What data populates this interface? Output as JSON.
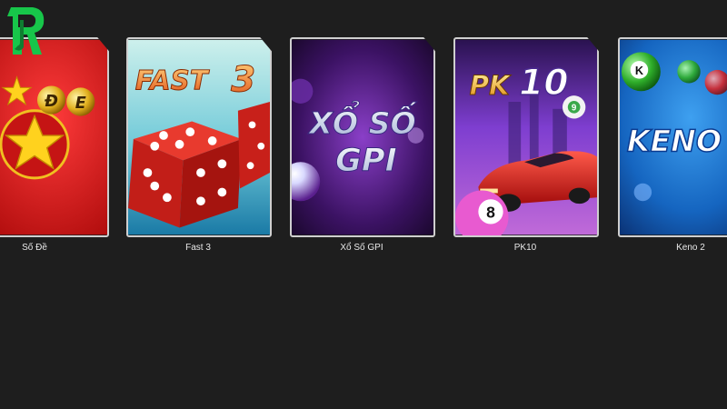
{
  "colors": {
    "background": "#1e1e1e",
    "card_border": "#cfcfcf",
    "logo_green": "#17c64a",
    "caption": "#e8e8e8"
  },
  "logo": {
    "icon": "brand-logo-icon"
  },
  "games": [
    {
      "id": "so-de",
      "title": "Số Đề",
      "art_text": [
        "Đ",
        "E"
      ]
    },
    {
      "id": "fast-3",
      "title": "Fast 3",
      "art_text": [
        "FAST",
        "3"
      ]
    },
    {
      "id": "xo-so-gpi",
      "title": "Xổ Số GPI",
      "art_text": [
        "XỔ SỐ",
        "GPI"
      ]
    },
    {
      "id": "pk10",
      "title": "PK10",
      "art_text": [
        "PK",
        "10"
      ],
      "ball_numbers": [
        "9",
        "8"
      ]
    },
    {
      "id": "keno-2",
      "title": "Keno 2",
      "art_text": [
        "KENO"
      ],
      "ball_numbers": [
        "K"
      ]
    }
  ]
}
